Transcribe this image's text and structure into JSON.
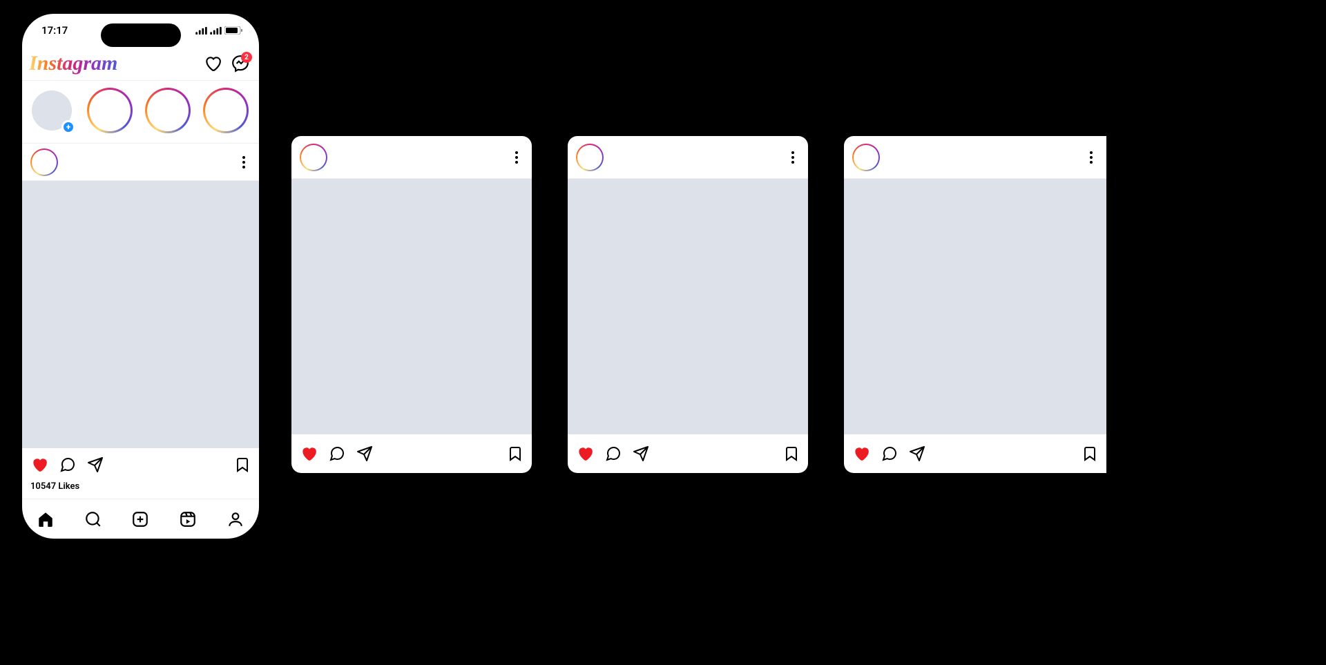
{
  "status_bar": {
    "time": "17:17"
  },
  "header": {
    "logo": "Instagram",
    "msg_badge": "2"
  },
  "post": {
    "likes_text": "10547 Likes"
  },
  "icons": {
    "heart": "heart",
    "messenger": "messenger",
    "home": "home",
    "search": "search",
    "add": "add",
    "reels": "reels",
    "profile": "profile"
  }
}
